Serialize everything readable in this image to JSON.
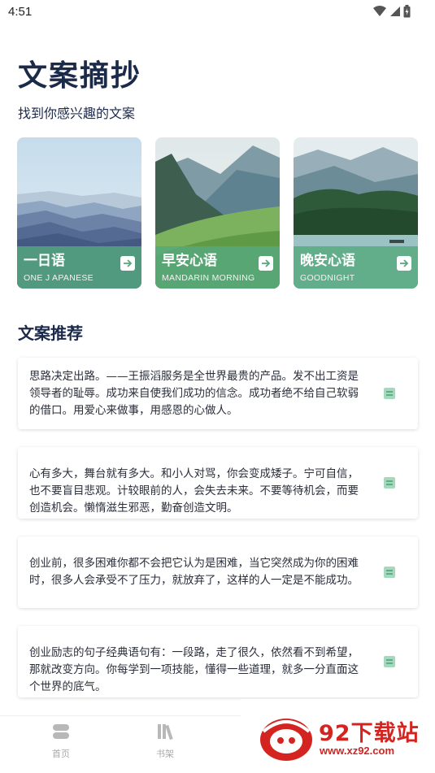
{
  "status_bar": {
    "time": "4:51"
  },
  "header": {
    "title": "文案摘抄",
    "subtitle": "找到你感兴趣的文案"
  },
  "cards": [
    {
      "title": "一日语",
      "subtitle": "ONE J APANESE",
      "icon": "arrow-right-icon"
    },
    {
      "title": "早安心语",
      "subtitle": "MANDARIN MORNING",
      "icon": "arrow-right-icon"
    },
    {
      "title": "晚安心语",
      "subtitle": "GOODNIGHT",
      "icon": "arrow-right-icon"
    }
  ],
  "section": {
    "title": "文案推荐"
  },
  "quotes": [
    {
      "text": "思路决定出路。——王振滔服务是全世界最贵的产品。发不出工资是领导者的耻辱。成功来自使我们成功的信念。成功者绝不给自己软弱的借口。用爱心来做事，用感恩的心做人。"
    },
    {
      "text": "心有多大，舞台就有多大。和小人对骂，你会变成矮子。宁可自信，也不要盲目悲观。计较眼前的人，会失去未来。不要等待机会，而要创造机会。懒惰滋生邪恶，勤奋创造文明。"
    },
    {
      "text": "创业前，很多困难你都不会把它认为是困难，当它突然成为你的困难时，很多人会承受不了压力，就放弃了，这样的人一定是不能成功。"
    },
    {
      "text": "创业励志的句子经典语句有：一段路，走了很久，依然看不到希望，那就改变方向。你每学到一项技能，懂得一些道理，就多一分直面这个世界的底气。"
    }
  ],
  "tabs": [
    {
      "label": "首页",
      "icon": "home-icon"
    },
    {
      "label": "书架",
      "icon": "bookshelf-icon"
    }
  ],
  "watermark": {
    "text": "92下载站",
    "url": "www.xz92.com"
  },
  "colors": {
    "accent": "#56a87e",
    "title": "#1c2a4a",
    "watermark": "#d42420"
  }
}
